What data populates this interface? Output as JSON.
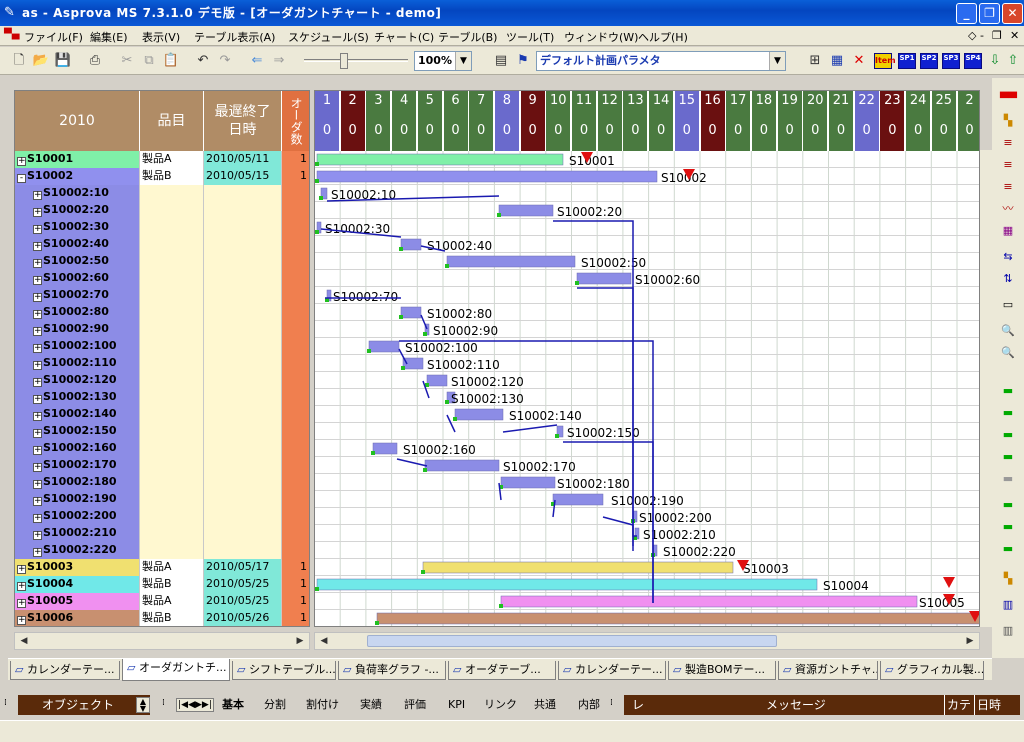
{
  "window": {
    "title": "as - Asprova MS 7.3.1.0 デモ版 - [オーダガントチャート - demo]"
  },
  "menu": [
    "ファイル(F)",
    "編集(E)",
    "表示(V)",
    "テーブル表示(A)",
    "スケジュール(S)",
    "チャート(C)",
    "テーブル(B)",
    "ツール(T)",
    "ウィンドウ(W)",
    "ヘルプ(H)"
  ],
  "toolbar": {
    "zoom": "100%",
    "param_set": "デフォルト計画パラメタ",
    "item_label": "Item",
    "sp_buttons": [
      "SP1",
      "SP2",
      "SP3",
      "SP4"
    ]
  },
  "table": {
    "headers": {
      "year": "2010",
      "item": "品目",
      "due_line1": "最遅終了",
      "due_line2": "日時",
      "count": "オーダ数"
    },
    "rows": [
      {
        "code": "S10001",
        "item": "製品A",
        "due": "2010/05/11",
        "count": "1",
        "level": 0,
        "expand": "+",
        "color": "#7ff0a8"
      },
      {
        "code": "S10002",
        "item": "製品B",
        "due": "2010/05/15",
        "count": "1",
        "level": 0,
        "expand": "-",
        "color": "#9090ee"
      },
      {
        "code": "S10002:10",
        "item": "",
        "due": "",
        "count": "",
        "level": 1,
        "expand": "+",
        "color": "#8c8ce6"
      },
      {
        "code": "S10002:20",
        "item": "",
        "due": "",
        "count": "",
        "level": 1,
        "expand": "+",
        "color": "#8c8ce6"
      },
      {
        "code": "S10002:30",
        "item": "",
        "due": "",
        "count": "",
        "level": 1,
        "expand": "+",
        "color": "#8c8ce6"
      },
      {
        "code": "S10002:40",
        "item": "",
        "due": "",
        "count": "",
        "level": 1,
        "expand": "+",
        "color": "#8c8ce6"
      },
      {
        "code": "S10002:50",
        "item": "",
        "due": "",
        "count": "",
        "level": 1,
        "expand": "+",
        "color": "#8c8ce6"
      },
      {
        "code": "S10002:60",
        "item": "",
        "due": "",
        "count": "",
        "level": 1,
        "expand": "+",
        "color": "#8c8ce6"
      },
      {
        "code": "S10002:70",
        "item": "",
        "due": "",
        "count": "",
        "level": 1,
        "expand": "+",
        "color": "#8c8ce6"
      },
      {
        "code": "S10002:80",
        "item": "",
        "due": "",
        "count": "",
        "level": 1,
        "expand": "+",
        "color": "#8c8ce6"
      },
      {
        "code": "S10002:90",
        "item": "",
        "due": "",
        "count": "",
        "level": 1,
        "expand": "+",
        "color": "#8c8ce6"
      },
      {
        "code": "S10002:100",
        "item": "",
        "due": "",
        "count": "",
        "level": 1,
        "expand": "+",
        "color": "#8c8ce6"
      },
      {
        "code": "S10002:110",
        "item": "",
        "due": "",
        "count": "",
        "level": 1,
        "expand": "+",
        "color": "#8c8ce6"
      },
      {
        "code": "S10002:120",
        "item": "",
        "due": "",
        "count": "",
        "level": 1,
        "expand": "+",
        "color": "#8c8ce6"
      },
      {
        "code": "S10002:130",
        "item": "",
        "due": "",
        "count": "",
        "level": 1,
        "expand": "+",
        "color": "#8c8ce6"
      },
      {
        "code": "S10002:140",
        "item": "",
        "due": "",
        "count": "",
        "level": 1,
        "expand": "+",
        "color": "#8c8ce6"
      },
      {
        "code": "S10002:150",
        "item": "",
        "due": "",
        "count": "",
        "level": 1,
        "expand": "+",
        "color": "#8c8ce6"
      },
      {
        "code": "S10002:160",
        "item": "",
        "due": "",
        "count": "",
        "level": 1,
        "expand": "+",
        "color": "#8c8ce6"
      },
      {
        "code": "S10002:170",
        "item": "",
        "due": "",
        "count": "",
        "level": 1,
        "expand": "+",
        "color": "#8c8ce6"
      },
      {
        "code": "S10002:180",
        "item": "",
        "due": "",
        "count": "",
        "level": 1,
        "expand": "+",
        "color": "#8c8ce6"
      },
      {
        "code": "S10002:190",
        "item": "",
        "due": "",
        "count": "",
        "level": 1,
        "expand": "+",
        "color": "#8c8ce6"
      },
      {
        "code": "S10002:200",
        "item": "",
        "due": "",
        "count": "",
        "level": 1,
        "expand": "+",
        "color": "#8c8ce6"
      },
      {
        "code": "S10002:210",
        "item": "",
        "due": "",
        "count": "",
        "level": 1,
        "expand": "+",
        "color": "#8c8ce6"
      },
      {
        "code": "S10002:220",
        "item": "",
        "due": "",
        "count": "",
        "level": 1,
        "expand": "+",
        "color": "#8c8ce6"
      },
      {
        "code": "S10003",
        "item": "製品A",
        "due": "2010/05/17",
        "count": "1",
        "level": 0,
        "expand": "+",
        "color": "#f0e070"
      },
      {
        "code": "S10004",
        "item": "製品B",
        "due": "2010/05/25",
        "count": "1",
        "level": 0,
        "expand": "+",
        "color": "#70e8e8"
      },
      {
        "code": "S10005",
        "item": "製品A",
        "due": "2010/05/25",
        "count": "1",
        "level": 0,
        "expand": "+",
        "color": "#f090f0"
      },
      {
        "code": "S10006",
        "item": "製品B",
        "due": "2010/05/26",
        "count": "1",
        "level": 0,
        "expand": "+",
        "color": "#c89070"
      }
    ]
  },
  "calendar": {
    "days": [
      {
        "d": "1",
        "z": "0",
        "c": "#6a6acc"
      },
      {
        "d": "2",
        "z": "0",
        "c": "#6a1010"
      },
      {
        "d": "3",
        "z": "0",
        "c": "#4a7a40"
      },
      {
        "d": "4",
        "z": "0",
        "c": "#4a7a40"
      },
      {
        "d": "5",
        "z": "0",
        "c": "#4a7a40"
      },
      {
        "d": "6",
        "z": "0",
        "c": "#4a7a40"
      },
      {
        "d": "7",
        "z": "0",
        "c": "#4a7a40"
      },
      {
        "d": "8",
        "z": "0",
        "c": "#6a6acc"
      },
      {
        "d": "9",
        "z": "0",
        "c": "#6a1010"
      },
      {
        "d": "10",
        "z": "0",
        "c": "#4a7a40"
      },
      {
        "d": "11",
        "z": "0",
        "c": "#4a7a40"
      },
      {
        "d": "12",
        "z": "0",
        "c": "#4a7a40"
      },
      {
        "d": "13",
        "z": "0",
        "c": "#4a7a40"
      },
      {
        "d": "14",
        "z": "0",
        "c": "#4a7a40"
      },
      {
        "d": "15",
        "z": "0",
        "c": "#6a6acc"
      },
      {
        "d": "16",
        "z": "0",
        "c": "#6a1010"
      },
      {
        "d": "17",
        "z": "0",
        "c": "#4a7a40"
      },
      {
        "d": "18",
        "z": "0",
        "c": "#4a7a40"
      },
      {
        "d": "19",
        "z": "0",
        "c": "#4a7a40"
      },
      {
        "d": "20",
        "z": "0",
        "c": "#4a7a40"
      },
      {
        "d": "21",
        "z": "0",
        "c": "#4a7a40"
      },
      {
        "d": "22",
        "z": "0",
        "c": "#6a6acc"
      },
      {
        "d": "23",
        "z": "0",
        "c": "#6a1010"
      },
      {
        "d": "24",
        "z": "0",
        "c": "#4a7a40"
      },
      {
        "d": "25",
        "z": "0",
        "c": "#4a7a40"
      },
      {
        "d": "2",
        "z": "0",
        "c": "#4a7a40"
      }
    ]
  },
  "gantt": {
    "bar_labels": [
      "S10001",
      "S10002",
      "S10002:10",
      "S10002:20",
      "S10002:30",
      "S10002:40",
      "S10002:50",
      "S10002:60",
      "S10002:70",
      "S10002:80",
      "S10002:90",
      "S10002:100",
      "S10002:110",
      "S10002:120",
      "S10002:130",
      "S10002:140",
      "S10002:150",
      "S10002:160",
      "S10002:170",
      "S10002:180",
      "S10002:190",
      "S10002:200",
      "S10002:210",
      "S10002:220",
      "S10003",
      "S10004",
      "S10005",
      ""
    ]
  },
  "tabs": [
    "カレンダーテー...",
    "オーダガントチ...",
    "シフトテーブル...",
    "負荷率グラフ -...",
    "オーダテーブ...",
    "カレンダーテー...",
    "製造BOMテー...",
    "資源ガントチャ...",
    "グラフィカル製..."
  ],
  "status": {
    "object_label": "オブジェクト",
    "bottom_tabs": [
      "基本",
      "分割",
      "割付け",
      "実績",
      "評価",
      "KPI",
      "リンク",
      "共通",
      "内部"
    ],
    "message_label": "メッセージ",
    "msg_col1": "レ",
    "msg_col2": "カテ",
    "msg_col3": "日時"
  }
}
